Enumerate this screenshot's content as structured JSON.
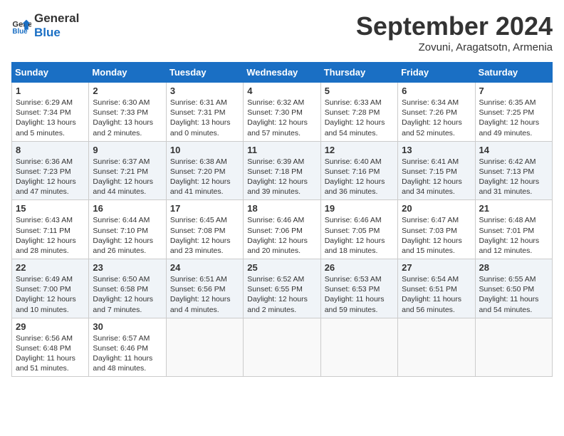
{
  "header": {
    "logo_line1": "General",
    "logo_line2": "Blue",
    "month": "September 2024",
    "location": "Zovuni, Aragatsotn, Armenia"
  },
  "columns": [
    "Sunday",
    "Monday",
    "Tuesday",
    "Wednesday",
    "Thursday",
    "Friday",
    "Saturday"
  ],
  "weeks": [
    [
      {
        "day": "1",
        "info": "Sunrise: 6:29 AM\nSunset: 7:34 PM\nDaylight: 13 hours\nand 5 minutes."
      },
      {
        "day": "2",
        "info": "Sunrise: 6:30 AM\nSunset: 7:33 PM\nDaylight: 13 hours\nand 2 minutes."
      },
      {
        "day": "3",
        "info": "Sunrise: 6:31 AM\nSunset: 7:31 PM\nDaylight: 13 hours\nand 0 minutes."
      },
      {
        "day": "4",
        "info": "Sunrise: 6:32 AM\nSunset: 7:30 PM\nDaylight: 12 hours\nand 57 minutes."
      },
      {
        "day": "5",
        "info": "Sunrise: 6:33 AM\nSunset: 7:28 PM\nDaylight: 12 hours\nand 54 minutes."
      },
      {
        "day": "6",
        "info": "Sunrise: 6:34 AM\nSunset: 7:26 PM\nDaylight: 12 hours\nand 52 minutes."
      },
      {
        "day": "7",
        "info": "Sunrise: 6:35 AM\nSunset: 7:25 PM\nDaylight: 12 hours\nand 49 minutes."
      }
    ],
    [
      {
        "day": "8",
        "info": "Sunrise: 6:36 AM\nSunset: 7:23 PM\nDaylight: 12 hours\nand 47 minutes."
      },
      {
        "day": "9",
        "info": "Sunrise: 6:37 AM\nSunset: 7:21 PM\nDaylight: 12 hours\nand 44 minutes."
      },
      {
        "day": "10",
        "info": "Sunrise: 6:38 AM\nSunset: 7:20 PM\nDaylight: 12 hours\nand 41 minutes."
      },
      {
        "day": "11",
        "info": "Sunrise: 6:39 AM\nSunset: 7:18 PM\nDaylight: 12 hours\nand 39 minutes."
      },
      {
        "day": "12",
        "info": "Sunrise: 6:40 AM\nSunset: 7:16 PM\nDaylight: 12 hours\nand 36 minutes."
      },
      {
        "day": "13",
        "info": "Sunrise: 6:41 AM\nSunset: 7:15 PM\nDaylight: 12 hours\nand 34 minutes."
      },
      {
        "day": "14",
        "info": "Sunrise: 6:42 AM\nSunset: 7:13 PM\nDaylight: 12 hours\nand 31 minutes."
      }
    ],
    [
      {
        "day": "15",
        "info": "Sunrise: 6:43 AM\nSunset: 7:11 PM\nDaylight: 12 hours\nand 28 minutes."
      },
      {
        "day": "16",
        "info": "Sunrise: 6:44 AM\nSunset: 7:10 PM\nDaylight: 12 hours\nand 26 minutes."
      },
      {
        "day": "17",
        "info": "Sunrise: 6:45 AM\nSunset: 7:08 PM\nDaylight: 12 hours\nand 23 minutes."
      },
      {
        "day": "18",
        "info": "Sunrise: 6:46 AM\nSunset: 7:06 PM\nDaylight: 12 hours\nand 20 minutes."
      },
      {
        "day": "19",
        "info": "Sunrise: 6:46 AM\nSunset: 7:05 PM\nDaylight: 12 hours\nand 18 minutes."
      },
      {
        "day": "20",
        "info": "Sunrise: 6:47 AM\nSunset: 7:03 PM\nDaylight: 12 hours\nand 15 minutes."
      },
      {
        "day": "21",
        "info": "Sunrise: 6:48 AM\nSunset: 7:01 PM\nDaylight: 12 hours\nand 12 minutes."
      }
    ],
    [
      {
        "day": "22",
        "info": "Sunrise: 6:49 AM\nSunset: 7:00 PM\nDaylight: 12 hours\nand 10 minutes."
      },
      {
        "day": "23",
        "info": "Sunrise: 6:50 AM\nSunset: 6:58 PM\nDaylight: 12 hours\nand 7 minutes."
      },
      {
        "day": "24",
        "info": "Sunrise: 6:51 AM\nSunset: 6:56 PM\nDaylight: 12 hours\nand 4 minutes."
      },
      {
        "day": "25",
        "info": "Sunrise: 6:52 AM\nSunset: 6:55 PM\nDaylight: 12 hours\nand 2 minutes."
      },
      {
        "day": "26",
        "info": "Sunrise: 6:53 AM\nSunset: 6:53 PM\nDaylight: 11 hours\nand 59 minutes."
      },
      {
        "day": "27",
        "info": "Sunrise: 6:54 AM\nSunset: 6:51 PM\nDaylight: 11 hours\nand 56 minutes."
      },
      {
        "day": "28",
        "info": "Sunrise: 6:55 AM\nSunset: 6:50 PM\nDaylight: 11 hours\nand 54 minutes."
      }
    ],
    [
      {
        "day": "29",
        "info": "Sunrise: 6:56 AM\nSunset: 6:48 PM\nDaylight: 11 hours\nand 51 minutes."
      },
      {
        "day": "30",
        "info": "Sunrise: 6:57 AM\nSunset: 6:46 PM\nDaylight: 11 hours\nand 48 minutes."
      },
      null,
      null,
      null,
      null,
      null
    ]
  ]
}
